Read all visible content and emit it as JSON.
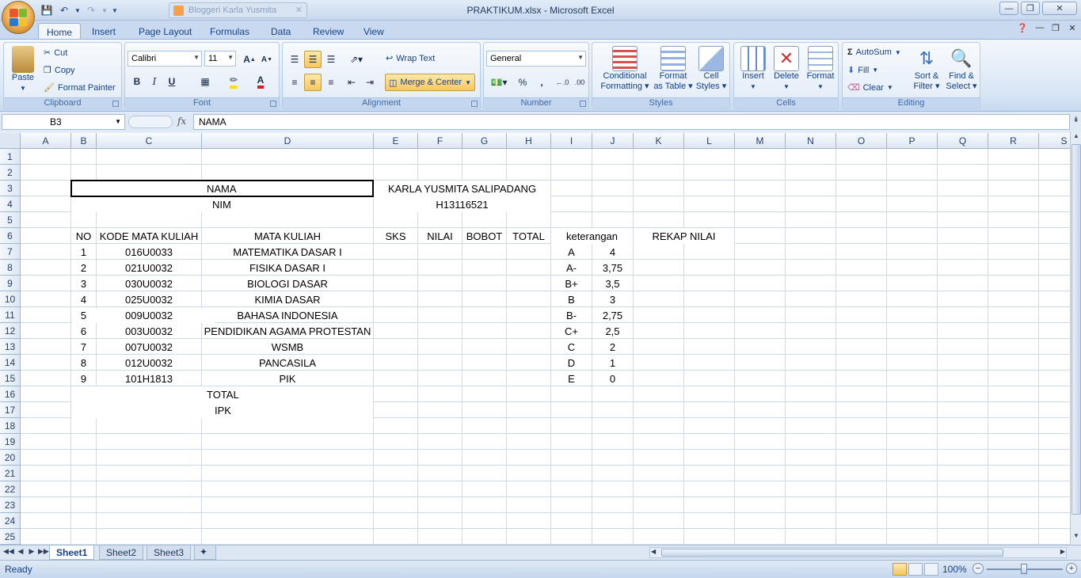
{
  "window": {
    "title": "PRAKTIKUM.xlsx - Microsoft Excel",
    "browser_tab": "Bloggeri Karla Yusmita"
  },
  "ribbon_tabs": [
    "Home",
    "Insert",
    "Page Layout",
    "Formulas",
    "Data",
    "Review",
    "View"
  ],
  "clipboard": {
    "paste": "Paste",
    "cut": "Cut",
    "copy": "Copy",
    "format_painter": "Format Painter",
    "label": "Clipboard"
  },
  "font": {
    "name": "Calibri",
    "size": "11",
    "bold": "B",
    "italic": "I",
    "underline": "U",
    "label": "Font"
  },
  "alignment": {
    "wrap_text": "Wrap Text",
    "merge_center": "Merge & Center",
    "label": "Alignment"
  },
  "number": {
    "format": "General",
    "percent": "%",
    "comma": ",",
    "label": "Number"
  },
  "styles": {
    "conditional_1": "Conditional",
    "conditional_2": "Formatting",
    "table_1": "Format",
    "table_2": "as Table",
    "cell_1": "Cell",
    "cell_2": "Styles",
    "label": "Styles"
  },
  "cells_group": {
    "insert": "Insert",
    "delete": "Delete",
    "format": "Format",
    "label": "Cells"
  },
  "editing": {
    "autosum": "AutoSum",
    "fill": "Fill",
    "clear": "Clear",
    "sort_1": "Sort &",
    "sort_2": "Filter",
    "find_1": "Find &",
    "find_2": "Select",
    "label": "Editing"
  },
  "formula_bar": {
    "name_box": "B3",
    "fx": "fx",
    "content": "NAMA"
  },
  "columns": [
    "A",
    "B",
    "C",
    "D",
    "E",
    "F",
    "G",
    "H",
    "I",
    "J",
    "K",
    "L",
    "M",
    "N",
    "O",
    "P",
    "Q",
    "R",
    "S"
  ],
  "rows": [
    "1",
    "2",
    "3",
    "4",
    "5",
    "6",
    "7",
    "8",
    "9",
    "10",
    "11",
    "12",
    "13",
    "14",
    "15",
    "16",
    "17",
    "18",
    "19",
    "20",
    "21",
    "22",
    "23",
    "24",
    "25"
  ],
  "sheet": {
    "nama_label": "NAMA",
    "nama_value": "KARLA YUSMITA SALIPADANG",
    "nim_label": "NIM",
    "nim_value": "H13116521",
    "headers": {
      "no": "NO",
      "kode": "KODE MATA KULIAH",
      "mata_kuliah": "MATA KULIAH",
      "sks": "SKS",
      "nilai": "NILAI",
      "bobot": "BOBOT",
      "total": "TOTAL",
      "keterangan": "keterangan",
      "rekap": "REKAP NILAI"
    },
    "courses": [
      {
        "no": "1",
        "kode": "016U0033",
        "nama": "MATEMATIKA DASAR I"
      },
      {
        "no": "2",
        "kode": "021U0032",
        "nama": "FISIKA DASAR I"
      },
      {
        "no": "3",
        "kode": "030U0032",
        "nama": "BIOLOGI DASAR"
      },
      {
        "no": "4",
        "kode": "025U0032",
        "nama": "KIMIA DASAR"
      },
      {
        "no": "5",
        "kode": "009U0032",
        "nama": "BAHASA INDONESIA"
      },
      {
        "no": "6",
        "kode": "003U0032",
        "nama": "PENDIDIKAN AGAMA PROTESTAN"
      },
      {
        "no": "7",
        "kode": "007U0032",
        "nama": "WSMB"
      },
      {
        "no": "8",
        "kode": "012U0032",
        "nama": "PANCASILA"
      },
      {
        "no": "9",
        "kode": "101H1813",
        "nama": "PIK"
      }
    ],
    "grades": [
      {
        "grade": "A",
        "value": "4"
      },
      {
        "grade": "A-",
        "value": "3,75"
      },
      {
        "grade": "B+",
        "value": "3,5"
      },
      {
        "grade": "B",
        "value": "3"
      },
      {
        "grade": "B-",
        "value": "2,75"
      },
      {
        "grade": "C+",
        "value": "2,5"
      },
      {
        "grade": "C",
        "value": "2"
      },
      {
        "grade": "D",
        "value": "1"
      },
      {
        "grade": "E",
        "value": "0"
      }
    ],
    "total_label": "TOTAL",
    "ipk_label": "IPK"
  },
  "sheet_tabs": [
    "Sheet1",
    "Sheet2",
    "Sheet3"
  ],
  "status": {
    "text": "Ready",
    "zoom": "100%"
  }
}
